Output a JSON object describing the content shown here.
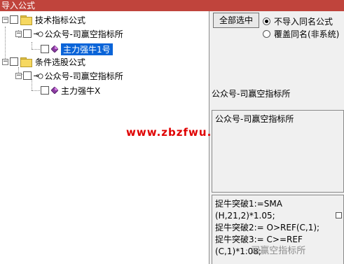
{
  "window": {
    "title": "导入公式"
  },
  "tree": {
    "groups": [
      {
        "label": "技术指标公式",
        "author": "公众号-司赢空指标所",
        "formula": "主力强牛1号",
        "formula_selected": true
      },
      {
        "label": "条件选股公式",
        "author": "公众号-司赢空指标所",
        "formula": "主力强牛X",
        "formula_selected": false
      }
    ],
    "watermark": "www.zbzfwu.com"
  },
  "controls": {
    "select_all_label": "全部选中",
    "radio_options": [
      {
        "label": "不导入同名公式",
        "checked": true
      },
      {
        "label": "覆盖同名(非系统)",
        "checked": false
      }
    ]
  },
  "info": {
    "name": "公众号-司赢空指标所",
    "description": "公众号-司赢空指标所",
    "formula_lines": [
      "捉牛突破1:=SMA",
      "(H,21,2)*1.05;",
      "捉牛突破2:= O>REF(C,1);",
      "捉牛突破3:= C>=REF",
      "(C,1)*1.08;"
    ]
  },
  "credit": "· 司赢空指标所",
  "colors": {
    "titlebar": "#c0443c",
    "selection": "#0a64d8",
    "watermark": "#e00000"
  }
}
